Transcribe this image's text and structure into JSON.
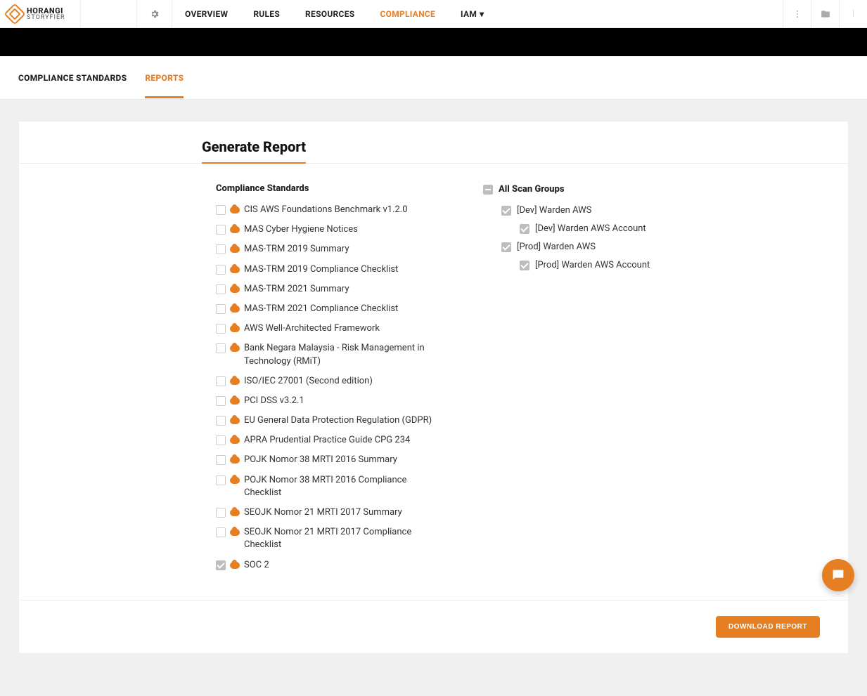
{
  "logo": {
    "main": "HORANGI",
    "sub": "STORYFIER"
  },
  "nav": {
    "items": [
      {
        "label": "OVERVIEW",
        "active": false
      },
      {
        "label": "RULES",
        "active": false
      },
      {
        "label": "RESOURCES",
        "active": false
      },
      {
        "label": "COMPLIANCE",
        "active": true
      },
      {
        "label": "IAM",
        "active": false,
        "caret": true
      }
    ]
  },
  "sub_tabs": [
    {
      "label": "COMPLIANCE STANDARDS",
      "active": false
    },
    {
      "label": "REPORTS",
      "active": true
    }
  ],
  "generate": {
    "title": "Generate Report",
    "standards_title": "Compliance Standards",
    "standards": [
      {
        "label": "CIS AWS Foundations Benchmark v1.2.0",
        "checked": false
      },
      {
        "label": "MAS Cyber Hygiene Notices",
        "checked": false
      },
      {
        "label": "MAS-TRM 2019 Summary",
        "checked": false
      },
      {
        "label": "MAS-TRM 2019 Compliance Checklist",
        "checked": false
      },
      {
        "label": "MAS-TRM 2021 Summary",
        "checked": false
      },
      {
        "label": "MAS-TRM 2021 Compliance Checklist",
        "checked": false
      },
      {
        "label": "AWS Well-Architected Framework",
        "checked": false
      },
      {
        "label": "Bank Negara Malaysia - Risk Management in Technology (RMiT)",
        "checked": false
      },
      {
        "label": "ISO/IEC 27001 (Second edition)",
        "checked": false
      },
      {
        "label": "PCI DSS v3.2.1",
        "checked": false
      },
      {
        "label": "EU General Data Protection Regulation (GDPR)",
        "checked": false
      },
      {
        "label": "APRA Prudential Practice Guide CPG 234",
        "checked": false
      },
      {
        "label": "POJK Nomor 38 MRTI 2016 Summary",
        "checked": false
      },
      {
        "label": "POJK Nomor 38 MRTI 2016 Compliance Checklist",
        "checked": false
      },
      {
        "label": "SEOJK Nomor 21 MRTI 2017 Summary",
        "checked": false
      },
      {
        "label": "SEOJK Nomor 21 MRTI 2017 Compliance Checklist",
        "checked": false
      },
      {
        "label": "SOC 2",
        "checked": true
      }
    ],
    "scan_title": "All Scan Groups",
    "scan_groups": [
      {
        "label": "[Dev] Warden AWS",
        "indent": 1,
        "checked": true
      },
      {
        "label": "[Dev] Warden AWS Account",
        "indent": 2,
        "checked": true
      },
      {
        "label": "[Prod] Warden AWS",
        "indent": 1,
        "checked": true
      },
      {
        "label": "[Prod] Warden AWS Account",
        "indent": 2,
        "checked": true
      }
    ],
    "download_label": "DOWNLOAD REPORT"
  },
  "colors": {
    "accent": "#e67e22"
  }
}
